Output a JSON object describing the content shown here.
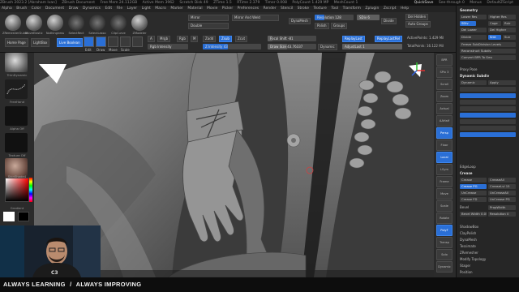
{
  "titlebar": {
    "app": "ZBrush 2023.2 [Abraham Ivan]",
    "document": "ZBrush Document",
    "stats": [
      "Free Mem 24.112GB",
      "Active Mem 3962",
      "Scratch Disk 49",
      "ZTime 1.5",
      "RTime 2.379",
      "Timer 0.008",
      "PolyCount 1.429 MP",
      "MeshCount 1"
    ],
    "right": [
      "QuickSave",
      "See-through 0",
      "Menus",
      "DefaultZScript"
    ]
  },
  "menubar": [
    "Alpha",
    "Brush",
    "Color",
    "Document",
    "Draw",
    "Dynamics",
    "Edit",
    "File",
    "Layer",
    "Light",
    "Macro",
    "Marker",
    "Material",
    "Movie",
    "Picker",
    "Preferences",
    "Render",
    "Stencil",
    "Stroke",
    "Texture",
    "Tool",
    "Transform",
    "Zplugin",
    "Zscript",
    "Help"
  ],
  "shelf": {
    "tools": [
      "ZRemesherGuide",
      "MoveElastic",
      "Nothingness",
      "SelectRect",
      "SelectLasso",
      "ClipCurve",
      "ZModeler"
    ],
    "home_page": "Home Page",
    "lightbox": "LightBox",
    "live_boolean": "Live Boolean",
    "edit": "Edit",
    "draw": "Draw",
    "move": "Move",
    "scale": "Scale",
    "rotate": "Rotate",
    "a_label": "A",
    "mrgb": "Mrgb",
    "rgb": "Rgb",
    "m": "M",
    "zadd": "Zadd",
    "zsub": "Zsub",
    "zcut": "Zcut",
    "rgb_intensity": "Rgb Intensity",
    "z_intensity": "Z Intensity 43",
    "focal_shift": "Focal Shift -81",
    "draw_size": "Draw Size 43.76337",
    "dynamic": "Dynamic",
    "replay_last": "ReplayLast",
    "replay_last_rel": "ReplayLastRel",
    "adjust_last": "AdjustLast 1",
    "active_points": "ActivePoints: 1.429 Mil",
    "total_points": "TotalPoints: 16.122 Mil",
    "mirror": "Mirror",
    "mirror_and_weld": "Mirror And Weld",
    "double": "Double",
    "dynamesh": "DynaMesh",
    "resolution": "Resolution 128",
    "polish": "Polish",
    "groups": "Groups",
    "sdiv": "SDiv 6",
    "divide": "Divide",
    "del_hidden": "Del Hidden",
    "auto_groups": "Auto Groups"
  },
  "lefttray": {
    "brush": "TrimDynamic",
    "stroke": "FreeHand",
    "alpha": "Alpha Off",
    "texture": "Texture Off",
    "material": "SkinShade4",
    "gradient": "Gradient"
  },
  "rstrip": [
    "BPR",
    "SPix 3",
    "Scroll",
    "Zoom",
    "Actual",
    "AAHalf",
    "Persp",
    "Floor",
    "Local",
    "LSym",
    "Frame",
    "Move",
    "Scale",
    "Rotate",
    "PolyF",
    "Transp",
    "Solo",
    "Dynamic"
  ],
  "palette": {
    "header": "Geometry",
    "lower_res": "Lower Res",
    "higher_res": "Higher Res",
    "sdiv": "SDiv",
    "cage": "Cage",
    "rstr": "Rstr",
    "del_lower": "Del Lower",
    "del_higher": "Del Higher",
    "divide": "Divide",
    "smt": "Smt",
    "suv": "Suv",
    "freeze": "Freeze SubDivision Levels",
    "reconstruct": "Reconstruct Subdiv",
    "convert_bpr": "Convert BPR To Geo",
    "proxy_pose": "Proxy Pose",
    "dynamic_subdiv": "Dynamic Subdiv",
    "dynamic": "Dynamic",
    "apply": "Apply",
    "edgeloop": "EdgeLoop",
    "crease": "Crease",
    "crease_pg": "Crease PG",
    "crease_all": "CreaseAll",
    "uncrease": "UnCrease",
    "uncrease_all": "UnCreaseAll",
    "crease_lvl": "CreaseLvl 15",
    "crease_fd": "Crease FD",
    "uncrease_pg": "UnCrease PG",
    "bevel": "Bevel",
    "prop_width": "PropWidth",
    "bevel_width": "Bevel Width 0.05",
    "resolution": "Resolution 0",
    "shadowbox": "ShadowBox",
    "claypolish": "ClayPolish",
    "dynamesh": "DynaMesh",
    "tessimate": "Tessimate",
    "zremesher": "ZRemesher",
    "modify_topology": "Modify Topology",
    "stager": "Stager",
    "position": "Position",
    "size": "Size",
    "mesh_integrity": "MeshIntegrity"
  },
  "banner": {
    "left": "ALWAYS LEARNING",
    "sep": "/",
    "right": "ALWAYS IMPROVING"
  },
  "colors": {
    "accent": "#2a6fd6",
    "ui_bg": "#2b2b2b",
    "viewport_bg": "#3a3a3a",
    "axis_x": "#e03030",
    "axis_y": "#30c030",
    "axis_z": "#3060e0"
  }
}
